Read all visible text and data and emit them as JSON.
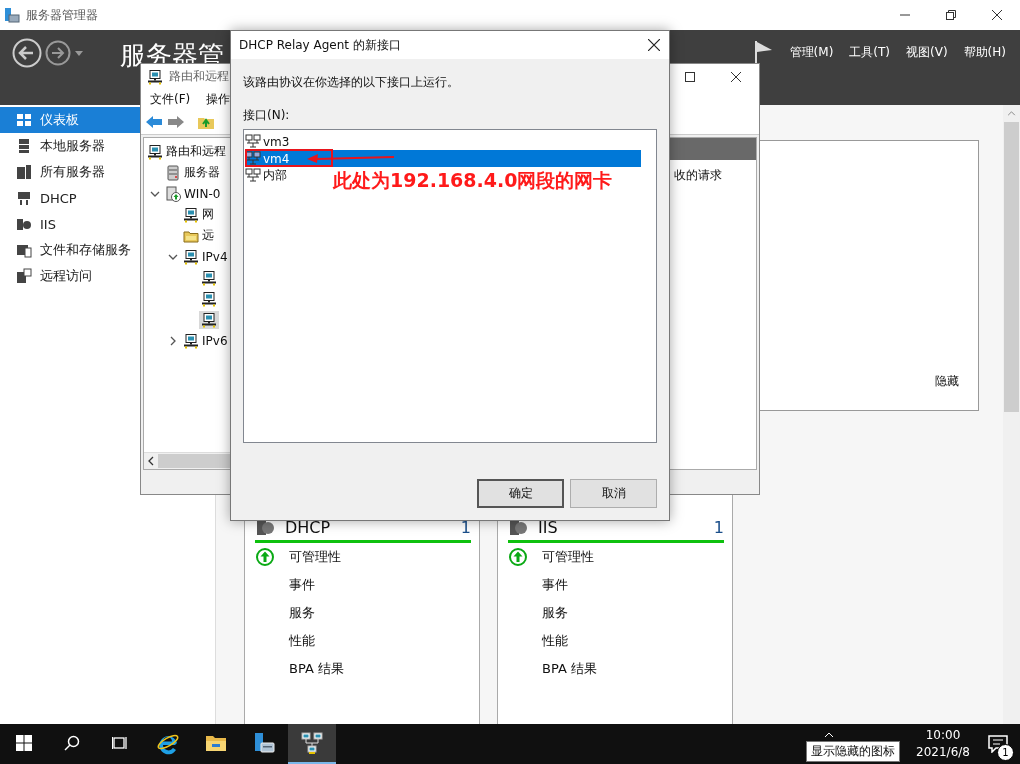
{
  "server_manager": {
    "title": "服务器管理器",
    "header_title": "服务器管",
    "menus": [
      "管理(M)",
      "工具(T)",
      "视图(V)",
      "帮助(H)"
    ],
    "nav": [
      {
        "label": "仪表板",
        "selected": true
      },
      {
        "label": "本地服务器",
        "selected": false
      },
      {
        "label": "所有服务器",
        "selected": false
      },
      {
        "label": "DHCP",
        "selected": false
      },
      {
        "label": "IIS",
        "selected": false
      },
      {
        "label": "文件和存储服务",
        "selected": false
      },
      {
        "label": "远程访问",
        "selected": false
      }
    ],
    "welcome": {
      "hide_link": "隐藏"
    },
    "tiles": [
      {
        "title": "DHCP",
        "count": "1",
        "rows": [
          {
            "label": "可管理性",
            "ok": true
          },
          {
            "label": "事件"
          },
          {
            "label": "服务"
          },
          {
            "label": "性能"
          },
          {
            "label": "BPA 结果"
          }
        ]
      },
      {
        "title": "IIS",
        "count": "1",
        "rows": [
          {
            "label": "可管理性",
            "ok": true
          },
          {
            "label": "事件"
          },
          {
            "label": "服务"
          },
          {
            "label": "性能"
          },
          {
            "label": "BPA 结果"
          }
        ]
      }
    ]
  },
  "rras": {
    "title": "路由和远程",
    "menus": [
      "文件(F)",
      "操作"
    ],
    "tree": [
      {
        "label": "路由和远程",
        "kind": "node",
        "selected": false,
        "children": [
          {
            "label": "服务器",
            "kind": "servers",
            "selected": false
          },
          {
            "label": "WIN-0",
            "kind": "server",
            "selected": false,
            "expanded": true,
            "children": [
              {
                "label": "网",
                "kind": "node",
                "selected": false
              },
              {
                "label": "远",
                "kind": "folder",
                "selected": false
              },
              {
                "label": "IPv4",
                "kind": "node",
                "selected": false,
                "expanded": true,
                "children": [
                  {
                    "kind": "node",
                    "selected": false
                  },
                  {
                    "kind": "node",
                    "selected": false
                  },
                  {
                    "kind": "node",
                    "selected": true
                  }
                ]
              },
              {
                "label": "IPv6",
                "kind": "node",
                "selected": false,
                "expanded": false
              }
            ]
          }
        ]
      }
    ],
    "detail_text": "收的请求"
  },
  "dialog": {
    "title": "DHCP Relay Agent 的新接口",
    "message": "该路由协议在你选择的以下接口上运行。",
    "list_label": "接口(N):",
    "interfaces": [
      {
        "name": "vm3",
        "selected": false
      },
      {
        "name": "vm4",
        "selected": true
      },
      {
        "name": "内部",
        "selected": false
      }
    ],
    "annotation": "此处为192.168.4.0网段的网卡",
    "buttons": [
      "确定",
      "取消"
    ]
  },
  "taskbar": {
    "apps": [
      {
        "kind": "start",
        "active": false
      },
      {
        "kind": "search",
        "active": false
      },
      {
        "kind": "taskview",
        "active": false
      },
      {
        "kind": "browser",
        "active": false
      },
      {
        "kind": "explorer",
        "active": false
      },
      {
        "kind": "servermanager",
        "active": false
      },
      {
        "kind": "network",
        "active": true
      }
    ],
    "tooltip": "显示隐藏的图标",
    "time": "10:00",
    "date": "2021/6/8",
    "notifications": "1"
  }
}
